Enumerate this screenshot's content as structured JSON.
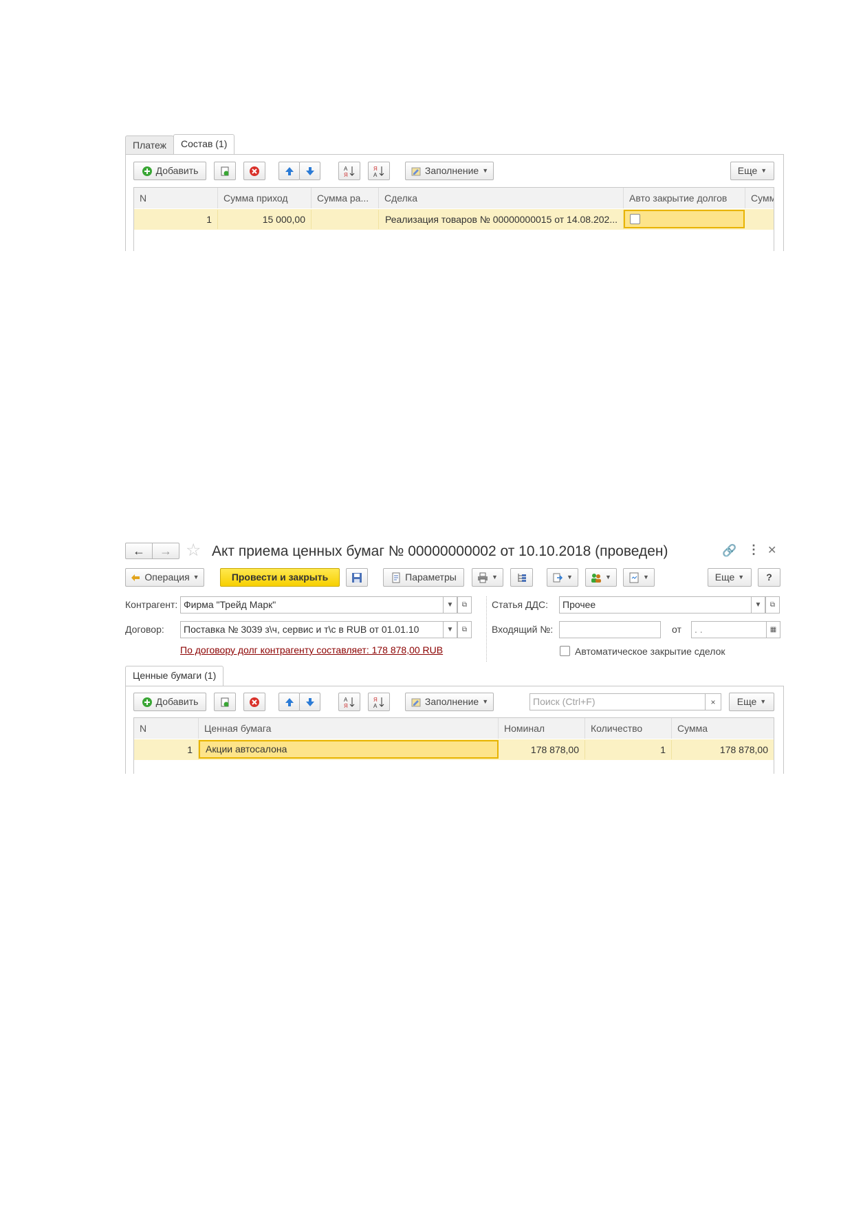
{
  "top_form": {
    "tabs": [
      "Платеж",
      "Состав (1)"
    ],
    "toolbar": {
      "add": "Добавить",
      "fill": "Заполнение",
      "more": "Еще"
    },
    "columns": [
      "N",
      "Сумма приход",
      "Сумма ра...",
      "Сделка",
      "Авто закрытие долгов",
      "Сумм"
    ],
    "row": {
      "n": "1",
      "amount_in": "15 000,00",
      "amount_out": "",
      "deal": "Реализация товаров № 00000000015 от 14.08.202...",
      "auto_close_checked": false
    }
  },
  "bottom_form": {
    "title": "Акт приема ценных бумаг № 00000000002 от 10.10.2018 (проведен)",
    "toolbar": {
      "operation": "Операция",
      "post_close": "Провести и закрыть",
      "params": "Параметры",
      "more": "Еще",
      "help": "?"
    },
    "fields": {
      "counterparty_label": "Контрагент:",
      "counterparty_value": "Фирма \"Трейд Марк\"",
      "contract_label": "Договор:",
      "contract_value": "Поставка № 3039 з\\ч, сервис и т\\с в RUB от 01.01.10",
      "debt_link": "По договору долг контрагенту составляет: 178 878,00 RUB",
      "dds_label": "Статья ДДС:",
      "dds_value": "Прочее",
      "incoming_label": "Входящий №:",
      "incoming_value": "",
      "from_label": "от",
      "date_value": " .  .",
      "auto_close_label": "Автоматическое закрытие сделок"
    },
    "tab": "Ценные бумаги (1)",
    "table_toolbar": {
      "add": "Добавить",
      "fill": "Заполнение",
      "search_placeholder": "Поиск (Ctrl+F)",
      "more": "Еще"
    },
    "columns": [
      "N",
      "Ценная бумага",
      "Номинал",
      "Количество",
      "Сумма"
    ],
    "row": {
      "n": "1",
      "security": "Акции автосалона",
      "nominal": "178 878,00",
      "quantity": "1",
      "sum": "178 878,00"
    }
  },
  "colors": {
    "row_highlight": "#fbf1c4",
    "active_cell": "#fde48a",
    "active_border": "#e8b400",
    "primary_button": "#f7d000",
    "link_red": "#8b0000"
  }
}
